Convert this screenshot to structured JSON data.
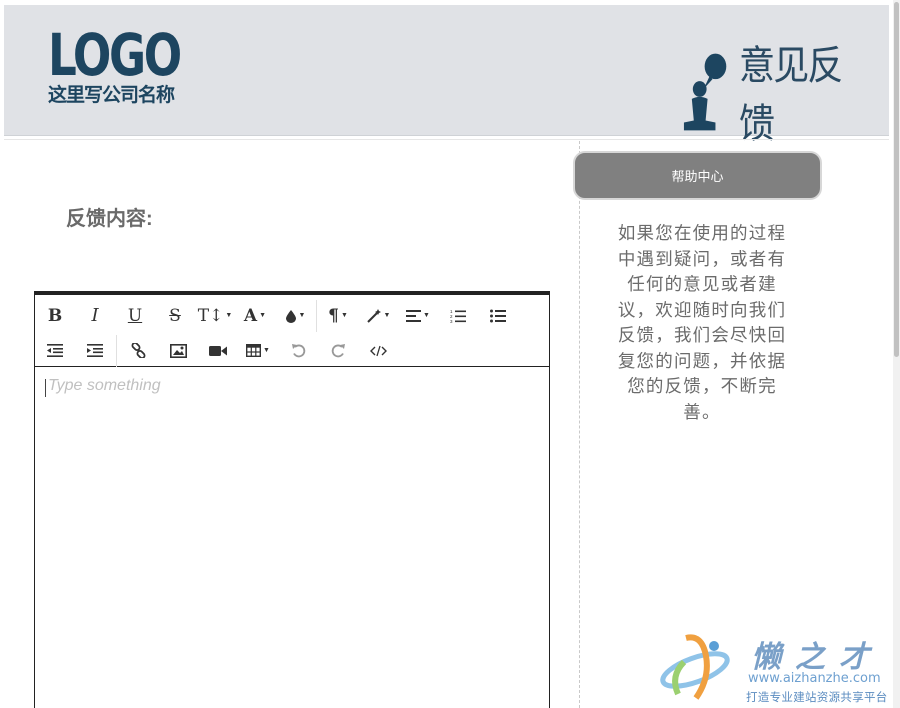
{
  "header": {
    "logo_text": "LOGO",
    "logo_subtitle": "这里写公司名称",
    "title": "意见反馈",
    "brand_color": "#1d4560"
  },
  "form": {
    "content_label": "反馈内容:"
  },
  "editor": {
    "placeholder": "Type something",
    "toolbar_row1": [
      "bold-icon",
      "italic-icon",
      "underline-icon",
      "strikethrough-icon",
      "font-size-icon",
      "font-color-icon",
      "highlight-icon",
      "paragraph-icon",
      "magic-style-icon",
      "align-icon",
      "ordered-list-icon",
      "unordered-list-icon"
    ],
    "toolbar_row2": [
      "outdent-icon",
      "indent-icon",
      "link-icon",
      "image-icon",
      "video-icon",
      "table-icon",
      "undo-icon",
      "redo-icon",
      "code-view-icon"
    ]
  },
  "sidebar": {
    "help_button_label": "帮助中心",
    "help_text": "如果您在使用的过程中遇到疑问，或者有任何的意见或者建议，欢迎随时向我们反馈，我们会尽快回复您的问题，并依据您的反馈，不断完善。"
  },
  "watermark": {
    "title": "懒之才",
    "url": "www.aizhanzhe.com",
    "slogan": "打造专业建站资源共享平台"
  }
}
